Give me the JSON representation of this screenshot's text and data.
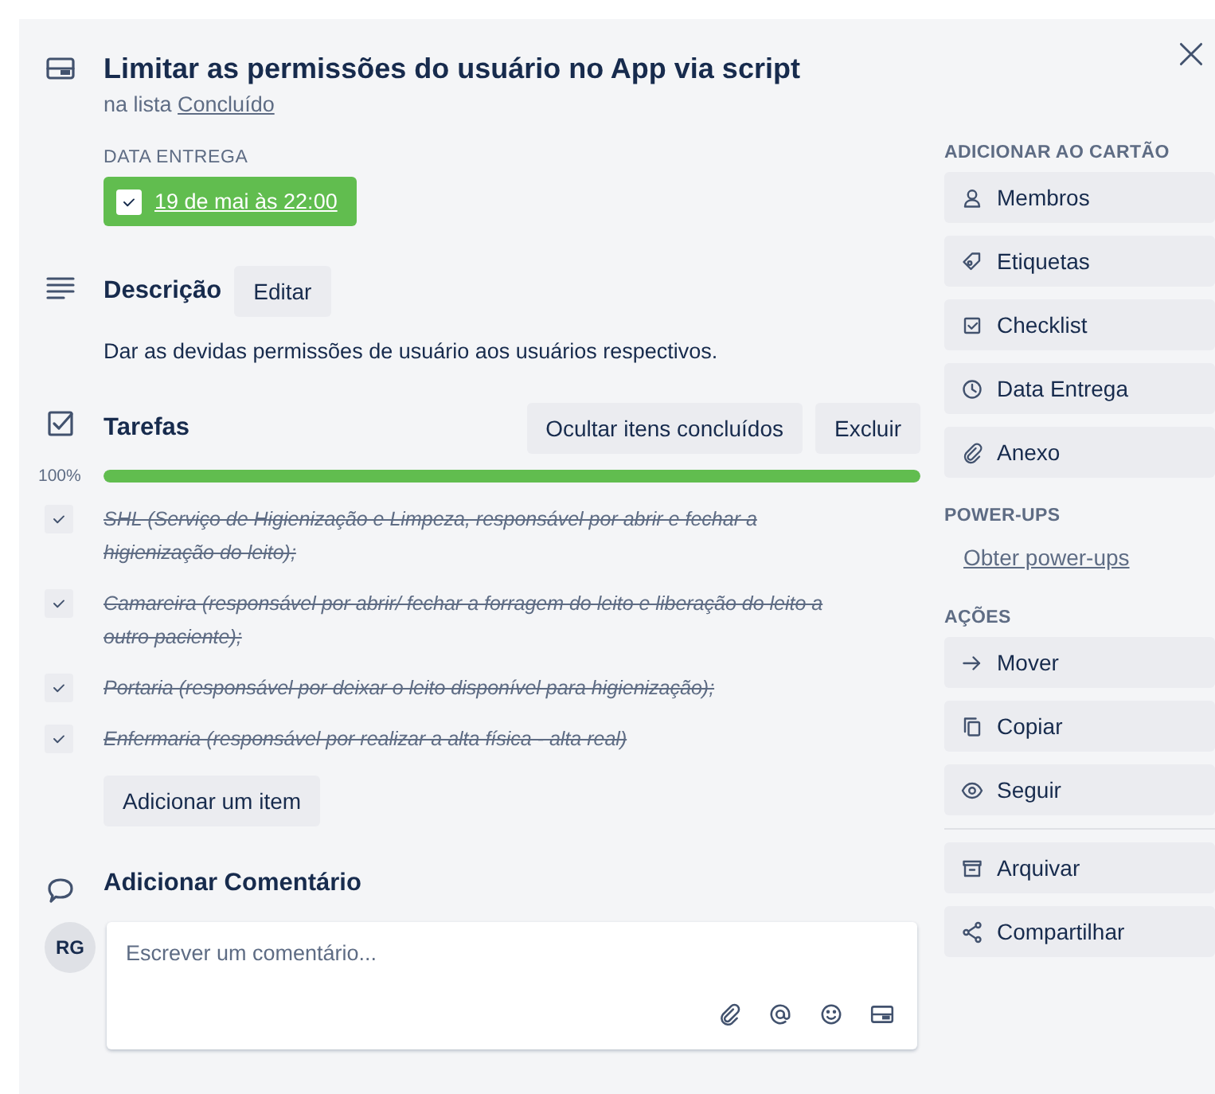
{
  "card": {
    "title": "Limitar as permissões do usuário no App via script",
    "list_prefix": "na lista",
    "list_name": "Concluído"
  },
  "due": {
    "label": "DATA ENTREGA",
    "date": "19 de mai às 22:00",
    "complete": true
  },
  "description": {
    "title": "Descrição",
    "edit": "Editar",
    "text": "Dar as devidas permissões de usuário aos usuários respectivos."
  },
  "checklist": {
    "title": "Tarefas",
    "buttons": [
      "Ocultar itens concluídos",
      "Excluir"
    ],
    "percent": "100%",
    "level": 1,
    "items": [
      {
        "text": "SHL (Serviço de Higienização e Limpeza, responsável por abrir e fechar a higienização do leito);",
        "checked": true
      },
      {
        "text": "Camareira (responsável por abrir/ fechar a forragem do leito e liberação do leito a outro paciente);",
        "checked": true
      },
      {
        "text": "Portaria (responsável por deixar o leito disponível para higienização);",
        "checked": true
      },
      {
        "text": "Enfermaria (responsável por realizar a alta física - alta real)",
        "checked": true
      }
    ],
    "add": "Adicionar um item"
  },
  "comment": {
    "title": "Adicionar Comentário",
    "avatar": "RG",
    "placeholder": "Escrever um comentário..."
  },
  "sidebar": [
    {
      "kind": "buttons",
      "title": "ADICIONAR AO CARTÃO",
      "items": [
        "Membros",
        "Etiquetas",
        "Checklist",
        "Data Entrega",
        "Anexo"
      ]
    },
    {
      "kind": "links",
      "title": "POWER-UPS",
      "items": [
        "Obter power-ups"
      ]
    },
    {
      "kind": "buttons",
      "title": "AÇÕES",
      "items": [
        "Mover",
        "Copiar",
        "Seguir"
      ]
    },
    {
      "kind": "buttons",
      "items": [
        "Arquivar",
        "Compartilhar"
      ]
    }
  ]
}
